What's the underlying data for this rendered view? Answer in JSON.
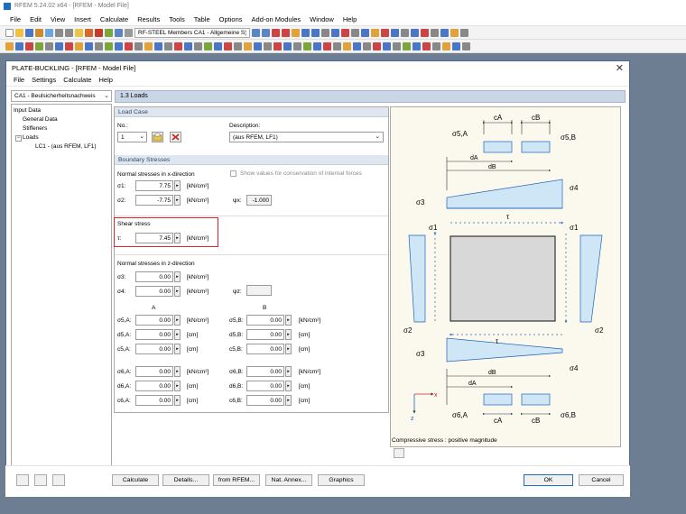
{
  "app": {
    "title": "RFEM 5.24.02 x64 - [RFEM - Model File]"
  },
  "menubar": [
    "File",
    "Edit",
    "View",
    "Insert",
    "Calculate",
    "Results",
    "Tools",
    "Table",
    "Options",
    "Add-on Modules",
    "Window",
    "Help"
  ],
  "toolbar": {
    "module_combo": "RF-STEEL Members CA1 - Allgemeine S¦"
  },
  "dialog": {
    "title": "PLATE-BUCKLING - [RFEM - Model File]",
    "close": "✕",
    "menu": [
      "File",
      "Settings",
      "Calculate",
      "Help"
    ],
    "case_combo": "CA1 - Beulsicherheitsnachweis",
    "tree": {
      "root": "Input Data",
      "general": "General Data",
      "stiffeners": "Stiffeners",
      "loads": "Loads",
      "lc1": "LC1 -  (aus RFEM, LF1)"
    },
    "section_header": "1.3 Loads",
    "load_case": {
      "title": "Load Case",
      "no_label": "No.:",
      "no_value": "1",
      "desc_label": "Description:",
      "desc_value": "(aus RFEM, LF1)"
    },
    "boundary": {
      "title": "Boundary Stresses",
      "x_title": "Normal stresses in x-direction",
      "conservation_label": "Show values for conservation of internal forces",
      "s1_label": "σ1:",
      "s1_value": "7.75",
      "s2_label": "σ2:",
      "s2_value": "-7.75",
      "psix_label": "ψx:",
      "psix_value": "-1.000",
      "unit_stress": "[kN/cm²]",
      "shear_title": "Shear stress",
      "tau_label": "τ:",
      "tau_value": "7.45",
      "z_title": "Normal stresses in z-direction",
      "s3_label": "σ3:",
      "s3_value": "0.00",
      "s4_label": "σ4:",
      "s4_value": "0.00",
      "psiz_label": "ψz:",
      "col_a": "A",
      "col_b": "B",
      "unit_len": "[cm]"
    },
    "rows_a1": [
      {
        "label": "σ5,A:",
        "value": "0.00",
        "unit": "[kN/cm²]"
      },
      {
        "label": "d5,A:",
        "value": "0.00",
        "unit": "[cm]"
      },
      {
        "label": "c5,A:",
        "value": "0.00",
        "unit": "[cm]"
      }
    ],
    "rows_b1": [
      {
        "label": "σ5,B:",
        "value": "0.00",
        "unit": "[kN/cm²]"
      },
      {
        "label": "d5,B:",
        "value": "0.00",
        "unit": "[cm]"
      },
      {
        "label": "c5,B:",
        "value": "0.00",
        "unit": "[cm]"
      }
    ],
    "rows_a2": [
      {
        "label": "σ6,A:",
        "value": "0.00",
        "unit": "[kN/cm²]"
      },
      {
        "label": "d6,A:",
        "value": "0.00",
        "unit": "[cm]"
      },
      {
        "label": "c6,A:",
        "value": "0.00",
        "unit": "[cm]"
      }
    ],
    "rows_b2": [
      {
        "label": "σ6,B:",
        "value": "0.00",
        "unit": "[kN/cm²]"
      },
      {
        "label": "d6,B:",
        "value": "0.00",
        "unit": "[cm]"
      },
      {
        "label": "c6,B:",
        "value": "0.00",
        "unit": "[cm]"
      }
    ],
    "graphic": {
      "caption": "Compressive stress : positive magnitude",
      "labels": {
        "cA": "cA",
        "cB": "cB",
        "s5A": "σ5,A",
        "s5B": "σ5,B",
        "dA": "dA",
        "dB": "dB",
        "s3": "σ3",
        "s4": "σ4",
        "tau": "τ",
        "s1": "σ1",
        "s2": "σ2",
        "s6A": "σ6,A",
        "s6B": "σ6,B",
        "x": "x",
        "z": "z"
      }
    },
    "buttons": {
      "calculate": "Calculate",
      "details": "Details...",
      "from_rfem": "from RFEM...",
      "nat_annex": "Nat. Annex...",
      "graphics": "Graphics",
      "ok": "OK",
      "cancel": "Cancel"
    }
  },
  "colors": {
    "accent": "#1b6ec2",
    "highlight": "#e0232b",
    "stress_fill": "#cfe6f7",
    "stress_line": "#1f63b5"
  }
}
